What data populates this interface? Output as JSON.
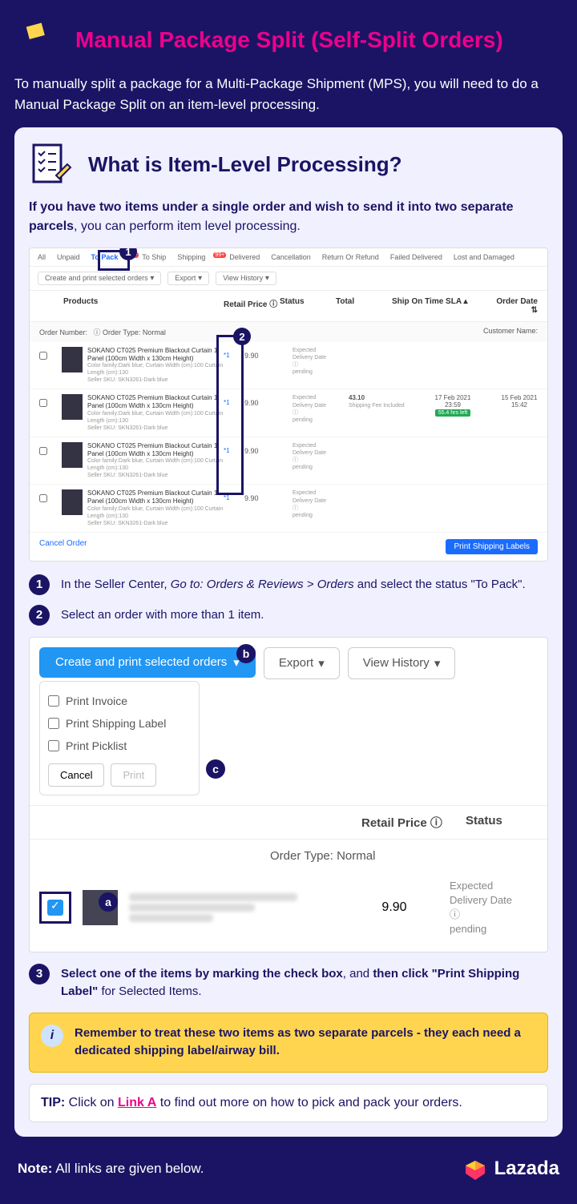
{
  "hero": {
    "title": "Manual Package Split (Self-Split Orders)"
  },
  "intro": "To manually split a package for a Multi-Package Shipment (MPS), you will need to do a Manual Package Split on an item-level processing.",
  "section": {
    "title": "What is Item-Level Processing?",
    "lead_a": "If you have two items under a single order and wish to send it into two separate parcels",
    "lead_b": ", you can perform item level processing."
  },
  "shot1": {
    "tabs": [
      "All",
      "Unpaid",
      "To Pack",
      "To Ship",
      "Shipping",
      "Delivered",
      "Cancellation",
      "Return Or Refund",
      "Failed Delivered",
      "Lost and Damaged"
    ],
    "badge99": "99+",
    "toolbar": {
      "create": "Create and print selected orders",
      "export": "Export",
      "history": "View History"
    },
    "cols": {
      "products": "Products",
      "retail": "Retail Price",
      "status": "Status",
      "total": "Total",
      "sla": "Ship On Time SLA",
      "orderdate": "Order Date"
    },
    "orderhead": {
      "num": "Order Number:",
      "type": "Order Type:",
      "typeval": "Normal",
      "cust": "Customer Name:"
    },
    "product": {
      "name": "SOKANO CT025 Premium Blackout Curtain 1 Panel (100cm Width x 130cm Height)",
      "meta": "Color family:Dark blue, Curtain Width (cm):100 Curtain Length (cm):130\nSeller SKU: SKN3261-Dark blue",
      "qty": "*1",
      "price": "9.90",
      "status": "Expected\nDelivery Date\nⓘ\npending",
      "total": "43.10",
      "totalnote": "Shipping Fee Included",
      "sla_date": "17 Feb 2021",
      "sla_time": "23:59",
      "sla_badge": "55.4 hrs left",
      "od_date": "15 Feb 2021",
      "od_time": "15:42"
    },
    "cancel": "Cancel Order",
    "printbtn": "Print Shipping Labels"
  },
  "steps": {
    "s1a": "In the Seller Center, ",
    "s1b": "Go to: Orders & Reviews > Orders",
    " s1c": " and select the status \"To Pack\".",
    "s2": "Select an order with more than 1 item.",
    "s3a": "Select one of the items by marking the check box",
    "s3b": ", and ",
    "s3c": "then click \"Print Shipping Label\"",
    "s3d": " for Selected Items."
  },
  "shot2": {
    "ddbtn": "Create and print selected orders",
    "export": "Export",
    "history": "View History",
    "opts": [
      "Print Invoice",
      "Print Shipping Label",
      "Print Picklist"
    ],
    "cancel": "Cancel",
    "print": "Print",
    "retail": "Retail Price ⓘ",
    "status": "Status",
    "otype": "Order Type:  Normal",
    "price": "9.90",
    "expected": "Expected\nDelivery Date",
    "pending": "pending",
    "info": "ⓘ"
  },
  "alert": "Remember to treat these two items as two separate parcels - they each need a dedicated shipping label/airway bill.",
  "tip": {
    "a": "TIP: ",
    "b": "Click on ",
    "link": "Link A",
    "c": " to find out more on how to pick and pack your orders."
  },
  "footer": {
    "note_a": "Note:",
    "note_b": " All links are given below.",
    "brand": "Lazada"
  },
  "nums": {
    "n1": "1",
    "n2": "2",
    "n3": "3",
    "la": "a",
    "lb": "b",
    "lc": "c"
  }
}
